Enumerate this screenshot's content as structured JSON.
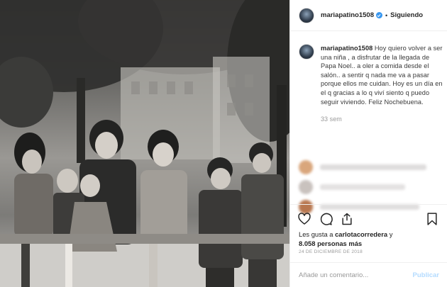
{
  "post": {
    "image_alt": "Fotografía en blanco y negro de una familia sentada en un banco",
    "username": "mariapatino1508",
    "follow_status": "Siguiendo",
    "separator": "•",
    "caption": "Hoy quiero volver a ser una niña , a disfrutar de la llegada de Papa Noel.. a oler a comida desde el salón.. a sentir q nada me va a pasar porque ellos me cuidan. Hoy es un día en el q gracias a lo q viví siento q puedo seguir viviendo. Feliz Nochebuena.",
    "time_ago": "33 sem",
    "likes_prefix": "Les gusta a",
    "likes_user": "carlotacorredera",
    "likes_joiner": "y",
    "likes_count": "8.058 personas más",
    "date": "24 DE DICIEMBRE DE 2018"
  },
  "comment_box": {
    "placeholder": "Añade un comentario...",
    "publish_label": "Publicar"
  },
  "colors": {
    "verified": "#3897f0",
    "publish_disabled": "#b3dbff",
    "muted": "#999999"
  },
  "icons": [
    "verified-badge-icon",
    "heart-icon",
    "comment-icon",
    "share-icon",
    "bookmark-icon"
  ]
}
